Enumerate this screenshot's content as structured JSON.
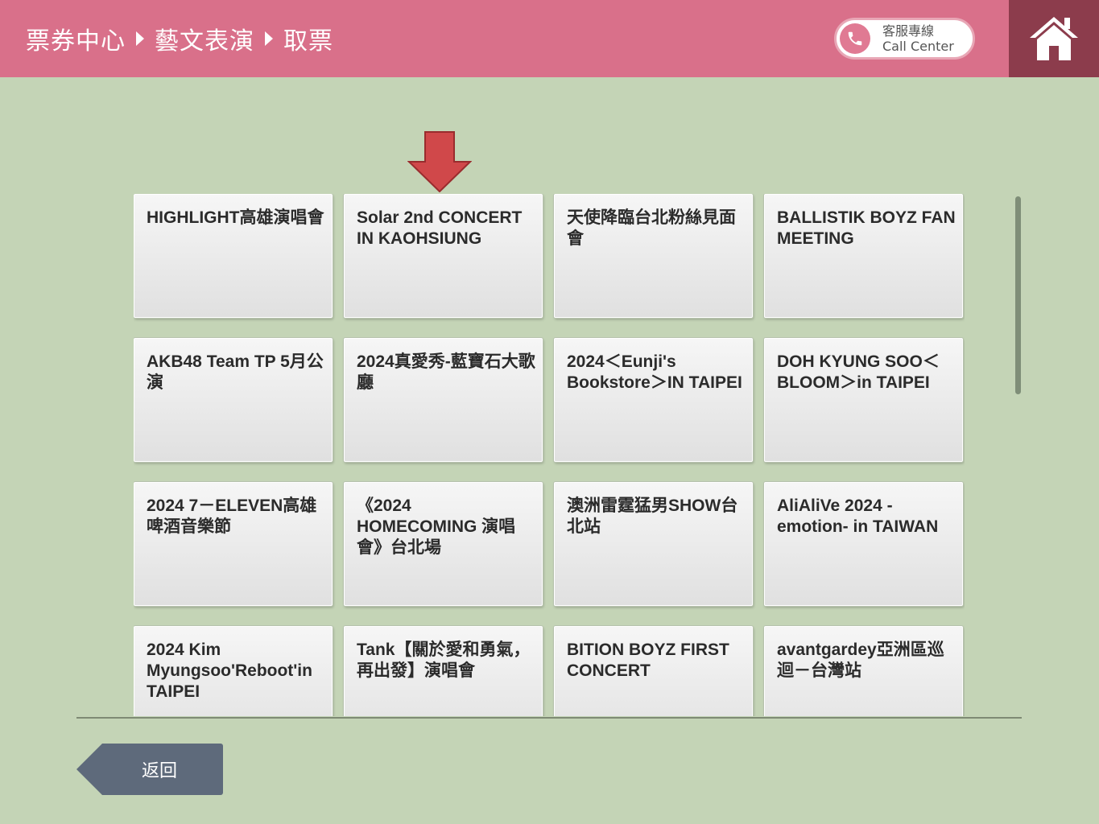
{
  "header": {
    "breadcrumb": [
      "票券中心",
      "藝文表演",
      "取票"
    ],
    "call_center": {
      "line1": "客服專線",
      "line2": "Call Center"
    }
  },
  "events": [
    "HIGHLIGHT高雄演唱會",
    "Solar 2nd CONCERT IN KAOHSIUNG",
    "天使降臨台北粉絲見面會",
    "BALLISTIK BOYZ FAN MEETING",
    "AKB48 Team TP 5月公演",
    "2024真愛秀-藍寶石大歌廳",
    "2024＜Eunji's Bookstore＞IN TAIPEI",
    "DOH KYUNG SOO＜BLOOM＞in TAIPEI",
    "2024 7－ELEVEN高雄啤酒音樂節",
    "《2024 HOMECOMING 演唱會》台北場",
    "澳洲雷霆猛男SHOW台北站",
    "AliAliVe 2024 -emotion- in TAIWAN",
    "2024 Kim Myungsoo'Reboot'in TAIPEI",
    "Tank【關於愛和勇氣，再出發】演唱會",
    "BITION BOYZ FIRST CONCERT",
    "avantgardey亞洲區巡迴－台灣站"
  ],
  "footer": {
    "back_label": "返回"
  },
  "colors": {
    "header": "#d9708a",
    "home": "#8c3c4c",
    "background": "#c4d4b6",
    "arrow": "#d0484a",
    "back_button": "#5e6a7b"
  },
  "icons": {
    "call": "phone-icon",
    "home": "home-icon",
    "pointer": "down-arrow-icon"
  }
}
